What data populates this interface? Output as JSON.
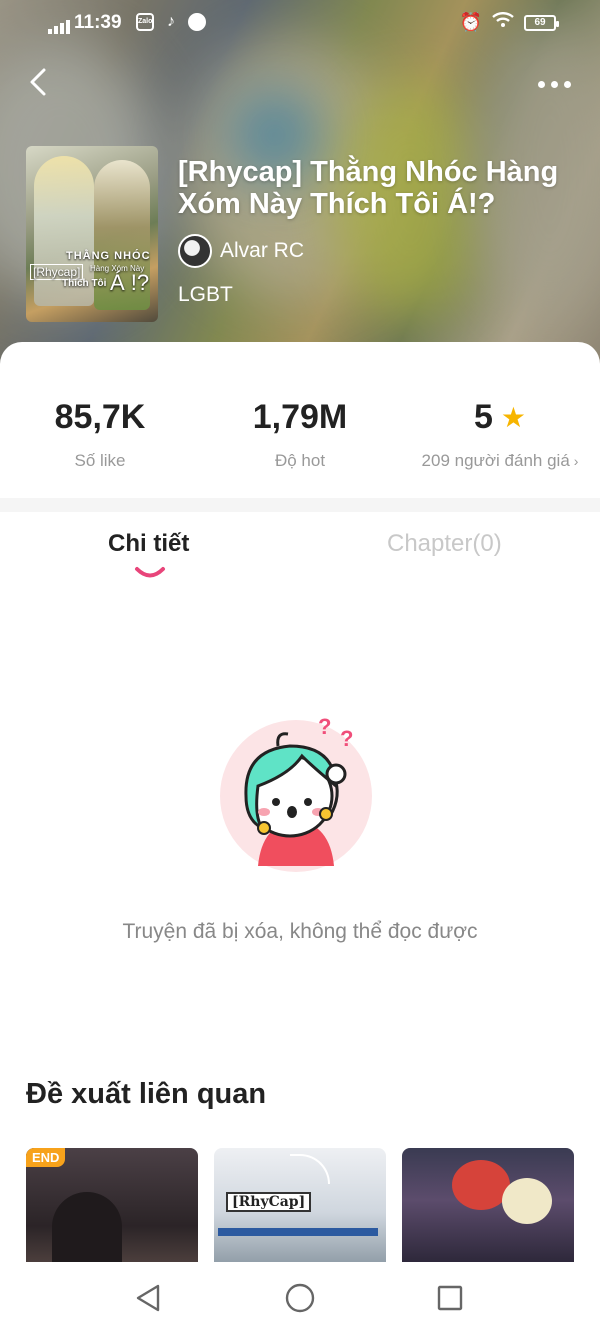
{
  "status_bar": {
    "time": "11:39",
    "battery": "69",
    "app_icons": [
      "Zalo",
      "TikTok",
      "browser"
    ]
  },
  "header": {
    "book_title": "[Rhycap] Thằng Nhóc Hàng Xóm Này Thích Tôi Á!?",
    "author": "Alvar RC",
    "genre": "LGBT",
    "cover_text": {
      "line1": "THẰNG NHÓC",
      "line2": "Hàng Xóm Này",
      "line3": "[Rhycap]",
      "line4": "Thích Tôi",
      "line5": "Á !?"
    },
    "icons": {
      "back": "chevron-left-icon",
      "more": "more-horizontal-icon"
    }
  },
  "stats": {
    "likes": {
      "value": "85,7K",
      "label": "Số like"
    },
    "hot": {
      "value": "1,79M",
      "label": "Độ hot"
    },
    "rating": {
      "value": "5",
      "label": "209 người đánh giá"
    }
  },
  "tabs": [
    {
      "label": "Chi tiết",
      "active": true
    },
    {
      "label": "Chapter(0)",
      "active": false
    }
  ],
  "empty_state": {
    "message": "Truyện đã bị xóa, không thể đọc được"
  },
  "related": {
    "title": "Đề xuất liên quan",
    "cards": [
      {
        "badge": "END"
      },
      {
        "tag": "[RhyCap]"
      },
      {}
    ]
  },
  "colors": {
    "accent": "#e8457a",
    "star": "#f7b500",
    "badge": "#f7a21b",
    "muted": "#999999"
  }
}
